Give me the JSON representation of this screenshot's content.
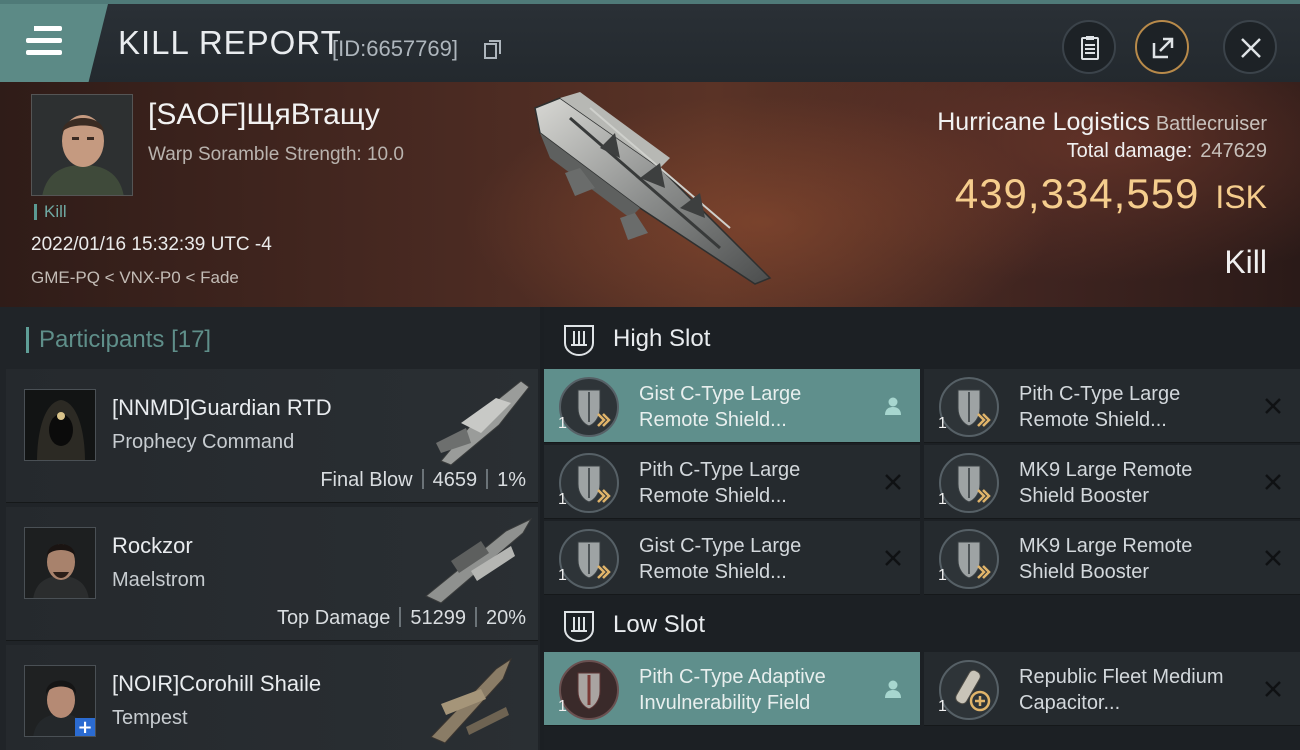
{
  "header": {
    "title": "KILL REPORT",
    "id_text": "[ID:6657769]",
    "icons": [
      "menu-icon",
      "copy-icon",
      "clipboard-icon",
      "share-icon",
      "close-icon"
    ]
  },
  "victim": {
    "pilot": "[SAOF]ЩяВтащу",
    "scramble": "Warp Soramble Strength: 10.0",
    "tag": "Kill",
    "datetime": "2022/01/16 15:32:39 UTC -4",
    "location": "GME-PQ < VNX-P0 < Fade",
    "ship_name": "Hurricane Logistics",
    "ship_class": "Battlecruiser",
    "total_damage_label": "Total damage:",
    "total_damage": "247629",
    "isk_value": "439,334,559",
    "isk_unit": "ISK",
    "result": "Kill"
  },
  "participants": {
    "title": "Participants",
    "count": "[17]",
    "list": [
      {
        "name": "[NNMD]Guardian RTD",
        "ship": "Prophecy Command",
        "label": "Final Blow",
        "damage": "4659",
        "percent": "1%"
      },
      {
        "name": "Rockzor",
        "ship": "Maelstrom",
        "label": "Top Damage",
        "damage": "51299",
        "percent": "20%"
      },
      {
        "name": "[NOIR]Corohill Shaile",
        "ship": "Tempest",
        "label": "",
        "damage": "",
        "percent": ""
      }
    ]
  },
  "fitting": {
    "high_slot_title": "High Slot",
    "low_slot_title": "Low Slot",
    "high_slot": [
      {
        "name": "Gist C-Type Large Remote Shield...",
        "qty": "1",
        "status": "pilot-icon"
      },
      {
        "name": "Pith C-Type Large Remote Shield...",
        "qty": "1",
        "status": "x-icon"
      },
      {
        "name": "Pith C-Type Large Remote Shield...",
        "qty": "1",
        "status": "x-icon"
      },
      {
        "name": "MK9 Large Remote Shield Booster",
        "qty": "1",
        "status": "x-icon"
      },
      {
        "name": "Gist C-Type Large Remote Shield...",
        "qty": "1",
        "status": "x-icon"
      },
      {
        "name": "MK9 Large Remote Shield Booster",
        "qty": "1",
        "status": "x-icon"
      }
    ],
    "low_slot": [
      {
        "name": "Pith C-Type Adaptive Invulnerability Field",
        "qty": "1",
        "status": "pilot-icon"
      },
      {
        "name": "Republic Fleet Medium Capacitor...",
        "qty": "1",
        "status": "x-icon"
      }
    ]
  },
  "colors": {
    "accent": "#5f8f8c",
    "isk_gold": "#f5cd8d",
    "panel": "#252a2e"
  }
}
